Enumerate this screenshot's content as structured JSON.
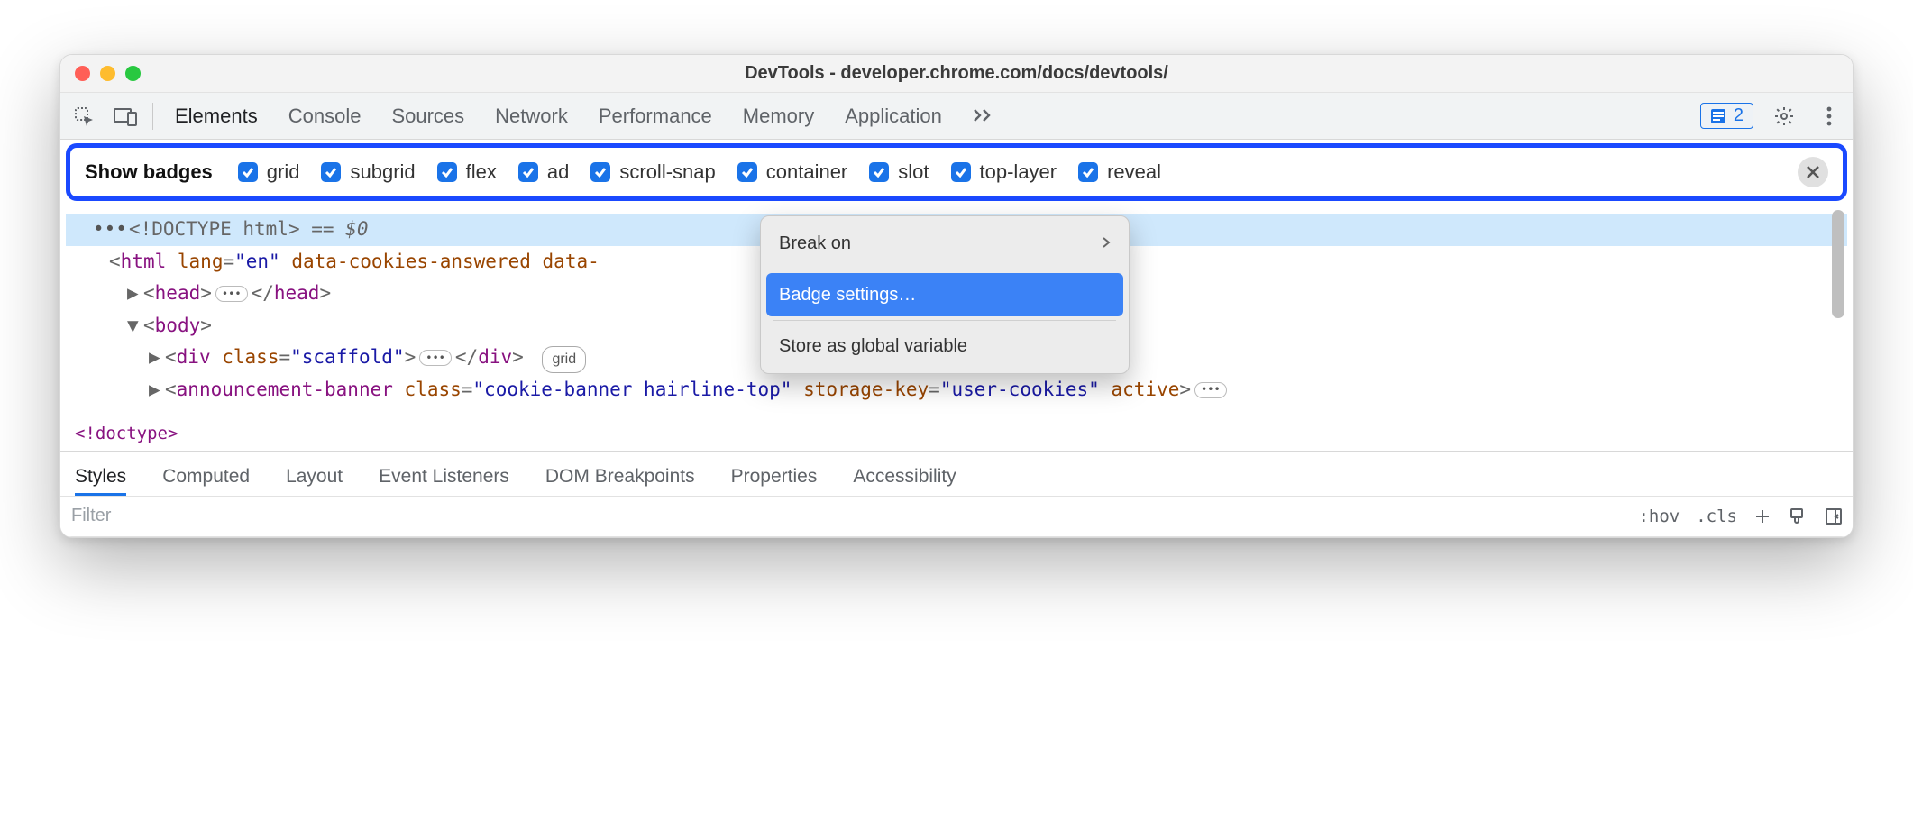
{
  "window_title": "DevTools - developer.chrome.com/docs/devtools/",
  "main_tabs": {
    "t0": "Elements",
    "t1": "Console",
    "t2": "Sources",
    "t3": "Network",
    "t4": "Performance",
    "t5": "Memory",
    "t6": "Application"
  },
  "issues_count": "2",
  "badges_bar": {
    "label": "Show badges",
    "items": {
      "b0": "grid",
      "b1": "subgrid",
      "b2": "flex",
      "b3": "ad",
      "b4": "scroll-snap",
      "b5": "container",
      "b6": "slot",
      "b7": "top-layer",
      "b8": "reveal"
    }
  },
  "context_menu": {
    "i0": "Break on",
    "i1": "Badge settings…",
    "i2": "Store as global variable"
  },
  "dom": {
    "doctype": "<!DOCTYPE html>",
    "eqzero": "== $0",
    "html_tag": "html",
    "html_attrs": {
      "a0_name": "lang",
      "a0_val": "\"en\"",
      "a1_name": "data-cookies-answered",
      "a2_name": "data-"
    },
    "head_tag": "head",
    "body_tag": "body",
    "div_tag": "div",
    "div_class_name": "class",
    "div_class_val": "\"scaffold\"",
    "grid_badge": "grid",
    "banner_tag": "announcement-banner",
    "banner_attrs": {
      "a0_name": "class",
      "a0_val": "\"cookie-banner hairline-top\"",
      "a1_name": "storage-key",
      "a1_val": "\"user-cookies\"",
      "a2_name": "active"
    }
  },
  "breadcrumb": "<!doctype>",
  "sub_tabs": {
    "s0": "Styles",
    "s1": "Computed",
    "s2": "Layout",
    "s3": "Event Listeners",
    "s4": "DOM Breakpoints",
    "s5": "Properties",
    "s6": "Accessibility"
  },
  "filter": {
    "placeholder": "Filter",
    "hov": ":hov",
    "cls": ".cls"
  }
}
